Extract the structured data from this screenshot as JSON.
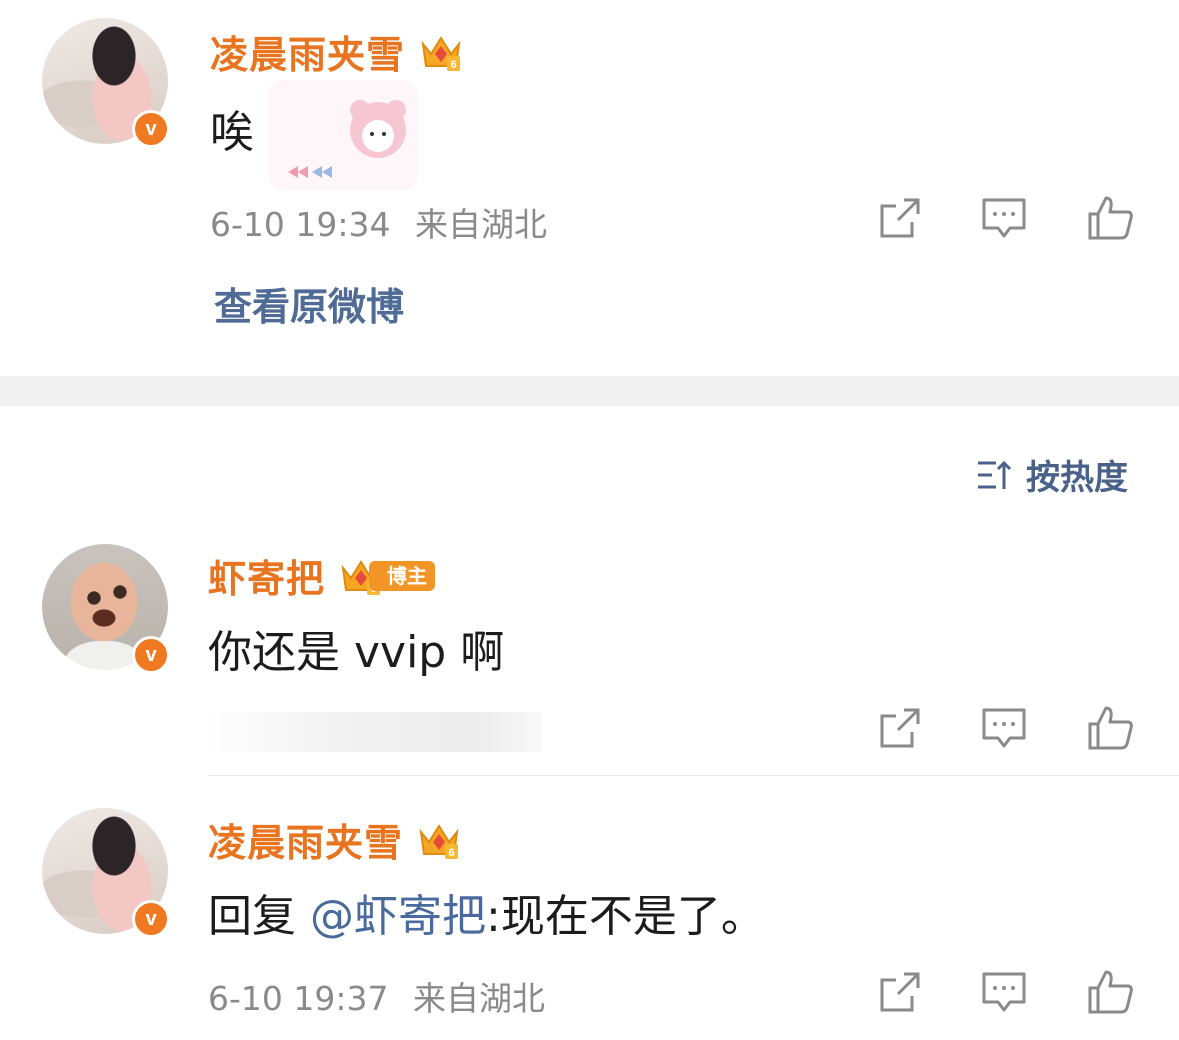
{
  "comments": [
    {
      "username": "凌晨雨夹雪",
      "text": "唉",
      "time": "6-10 19:34",
      "location": "来自湖北",
      "verified_mark": "v",
      "level_badge": "6",
      "avatar_icon": "avatar-girl",
      "view_original": "查看原微博"
    }
  ],
  "sort": {
    "label": "按热度",
    "icon": "sort-icon"
  },
  "replies": [
    {
      "username": "虾寄把",
      "level_badge": "6",
      "host_badge": "博主",
      "text": "你还是 vvip 啊",
      "verified_mark": "v",
      "avatar_icon": "avatar-baby"
    },
    {
      "username": "凌晨雨夹雪",
      "level_badge": "6",
      "reply_prefix": "回复 ",
      "mention": "@虾寄把",
      "text_after": ":现在不是了。",
      "time": "6-10 19:37",
      "location": "来自湖北",
      "verified_mark": "v",
      "avatar_icon": "avatar-girl"
    }
  ],
  "actions": {
    "share_icon": "share-icon",
    "comment_icon": "comment-icon",
    "like_icon": "like-icon"
  },
  "colors": {
    "username": "#e8741f",
    "link": "#506b95",
    "meta": "#8a8a8a",
    "verified": "#f07a21"
  }
}
